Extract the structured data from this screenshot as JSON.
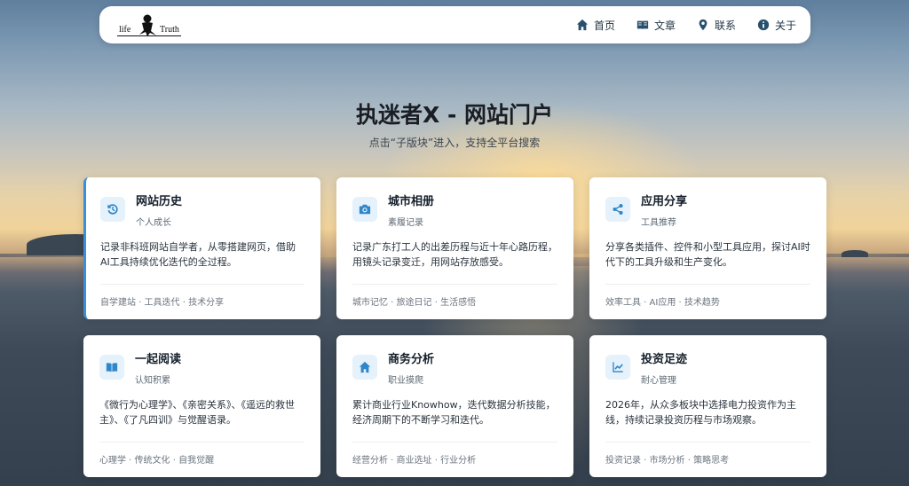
{
  "nav": {
    "logo": {
      "left": "life",
      "right": "Truth"
    },
    "items": [
      {
        "label": "首页",
        "icon": "home-icon"
      },
      {
        "label": "文章",
        "icon": "book-icon"
      },
      {
        "label": "联系",
        "icon": "map-pin-icon"
      },
      {
        "label": "关于",
        "icon": "info-icon"
      }
    ]
  },
  "hero": {
    "title": "执迷者X - 网站门户",
    "subtitle": "点击“子版块”进入，支持全平台搜索"
  },
  "cards": [
    {
      "title": "网站历史",
      "tag": "个人成长",
      "desc": "记录非科班网站自学者，从零搭建网页，借助AI工具持续优化迭代的全过程。",
      "keywords": "自学建站 · 工具迭代 · 技术分享",
      "icon": "history-icon"
    },
    {
      "title": "城市相册",
      "tag": "素履记录",
      "desc": "记录广东打工人的出差历程与近十年心路历程，用镜头记录变迁，用网站存放感受。",
      "keywords": "城市记忆 · 旅途日记 · 生活感悟",
      "icon": "camera-icon"
    },
    {
      "title": "应用分享",
      "tag": "工具推荐",
      "desc": "分享各类插件、控件和小型工具应用，探讨AI时代下的工具升级和生产变化。",
      "keywords": "效率工具 · AI应用 · 技术趋势",
      "icon": "share-icon"
    },
    {
      "title": "一起阅读",
      "tag": "认知积累",
      "desc": "《微行为心理学》、《亲密关系》、《遥远的救世主》、《了凡四训》与觉醒语录。",
      "keywords": "心理学 · 传统文化 · 自我觉醒",
      "icon": "open-book-icon"
    },
    {
      "title": "商务分析",
      "tag": "职业摸爬",
      "desc": "累计商业行业Knowhow，迭代数据分析技能，经济周期下的不断学习和迭代。",
      "keywords": "经营分析 · 商业选址 · 行业分析",
      "icon": "home-icon"
    },
    {
      "title": "投资足迹",
      "tag": "耐心管理",
      "desc": "2026年，从众多板块中选择电力投资作为主线，持续记录投资历程与市场观察。",
      "keywords": "投资记录 · 市场分析 · 策略思考",
      "icon": "chart-line-icon"
    }
  ],
  "colors": {
    "accent": "#3a8fd6",
    "icon_bg": "#e5f1fb",
    "nav_icon": "#28506d"
  }
}
